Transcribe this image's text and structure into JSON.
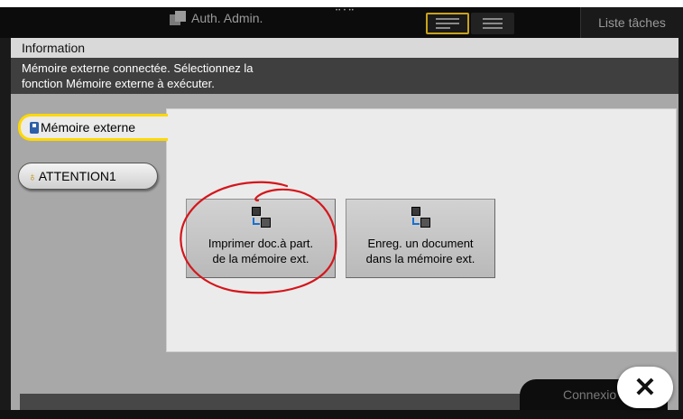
{
  "topbar": {
    "auth_label": "Auth. Admin.",
    "task_list_label": "Liste tâches"
  },
  "dialog": {
    "title": "Information",
    "message_line1": "Mémoire externe connectée. Sélectionnez la",
    "message_line2": "fonction Mémoire externe à exécuter."
  },
  "tabs": [
    {
      "label": "Mémoire externe",
      "icon": "usb-memory-icon",
      "active": true
    },
    {
      "label": "ATTENTION1",
      "icon": "lightbulb-icon",
      "active": false
    }
  ],
  "functions": [
    {
      "line1": "Imprimer doc.à part.",
      "line2": "de la mémoire ext.",
      "icon": "print-from-memory-icon"
    },
    {
      "line1": "Enreg. un document",
      "line2": "dans la mémoire ext.",
      "icon": "save-to-memory-icon"
    }
  ],
  "footer": {
    "connexion_label": "Connexio",
    "close_glyph": "✕"
  },
  "colors": {
    "accent": "#ffd800",
    "annotation": "#d4161c",
    "background": "#a8a8a8",
    "message_bar": "#3f3f3f"
  }
}
